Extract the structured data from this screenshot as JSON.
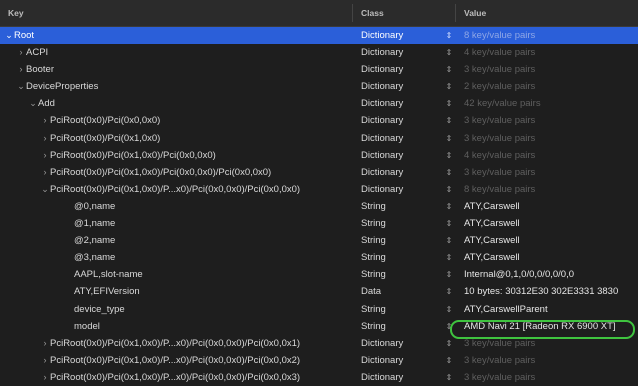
{
  "columns": {
    "key": "Key",
    "class": "Class",
    "value": "Value"
  },
  "rows": [
    {
      "depth": 0,
      "disc": "⌄",
      "key": "Root",
      "class": "Dictionary",
      "value": "8 key/value pairs",
      "dim": true,
      "selected": true
    },
    {
      "depth": 1,
      "disc": "›",
      "key": "ACPI",
      "class": "Dictionary",
      "value": "4 key/value pairs",
      "dim": true
    },
    {
      "depth": 1,
      "disc": "›",
      "key": "Booter",
      "class": "Dictionary",
      "value": "3 key/value pairs",
      "dim": true
    },
    {
      "depth": 1,
      "disc": "⌄",
      "key": "DeviceProperties",
      "class": "Dictionary",
      "value": "2 key/value pairs",
      "dim": true
    },
    {
      "depth": 2,
      "disc": "⌄",
      "key": "Add",
      "class": "Dictionary",
      "value": "42 key/value pairs",
      "dim": true
    },
    {
      "depth": 3,
      "disc": "›",
      "key": "PciRoot(0x0)/Pci(0x0,0x0)",
      "class": "Dictionary",
      "value": "3 key/value pairs",
      "dim": true
    },
    {
      "depth": 3,
      "disc": "›",
      "key": "PciRoot(0x0)/Pci(0x1,0x0)",
      "class": "Dictionary",
      "value": "3 key/value pairs",
      "dim": true
    },
    {
      "depth": 3,
      "disc": "›",
      "key": "PciRoot(0x0)/Pci(0x1,0x0)/Pci(0x0,0x0)",
      "class": "Dictionary",
      "value": "4 key/value pairs",
      "dim": true
    },
    {
      "depth": 3,
      "disc": "›",
      "key": "PciRoot(0x0)/Pci(0x1,0x0)/Pci(0x0,0x0)/Pci(0x0,0x0)",
      "class": "Dictionary",
      "value": "3 key/value pairs",
      "dim": true
    },
    {
      "depth": 3,
      "disc": "⌄",
      "key": "PciRoot(0x0)/Pci(0x1,0x0)/P...x0)/Pci(0x0,0x0)/Pci(0x0,0x0)",
      "class": "Dictionary",
      "value": "8 key/value pairs",
      "dim": true
    },
    {
      "depth": 5,
      "disc": "",
      "key": "@0,name",
      "class": "String",
      "value": "ATY,Carswell",
      "dim": false
    },
    {
      "depth": 5,
      "disc": "",
      "key": "@1,name",
      "class": "String",
      "value": "ATY,Carswell",
      "dim": false
    },
    {
      "depth": 5,
      "disc": "",
      "key": "@2,name",
      "class": "String",
      "value": "ATY,Carswell",
      "dim": false
    },
    {
      "depth": 5,
      "disc": "",
      "key": "@3,name",
      "class": "String",
      "value": "ATY,Carswell",
      "dim": false
    },
    {
      "depth": 5,
      "disc": "",
      "key": "AAPL,slot-name",
      "class": "String",
      "value": "Internal@0,1,0/0,0/0,0/0,0",
      "dim": false
    },
    {
      "depth": 5,
      "disc": "",
      "key": "ATY,EFIVersion",
      "class": "Data",
      "value": "10 bytes: 30312E30 302E3331 3830",
      "dim": false,
      "mixed": true
    },
    {
      "depth": 5,
      "disc": "",
      "key": "device_type",
      "class": "String",
      "value": "ATY,CarswellParent",
      "dim": false
    },
    {
      "depth": 5,
      "disc": "",
      "key": "model",
      "class": "String",
      "value": "AMD Navi 21 [Radeon RX 6900 XT]",
      "dim": false
    },
    {
      "depth": 3,
      "disc": "›",
      "key": "PciRoot(0x0)/Pci(0x1,0x0)/P...x0)/Pci(0x0,0x0)/Pci(0x0,0x1)",
      "class": "Dictionary",
      "value": "3 key/value pairs",
      "dim": true
    },
    {
      "depth": 3,
      "disc": "›",
      "key": "PciRoot(0x0)/Pci(0x1,0x0)/P...x0)/Pci(0x0,0x0)/Pci(0x0,0x2)",
      "class": "Dictionary",
      "value": "3 key/value pairs",
      "dim": true
    },
    {
      "depth": 3,
      "disc": "›",
      "key": "PciRoot(0x0)/Pci(0x1,0x0)/P...x0)/Pci(0x0,0x0)/Pci(0x0,0x3)",
      "class": "Dictionary",
      "value": "3 key/value pairs",
      "dim": true
    }
  ],
  "highlight_color": "#3fc43f",
  "selection_color": "#2b5fd9",
  "stepper_icon": "up-down-arrows-icon"
}
